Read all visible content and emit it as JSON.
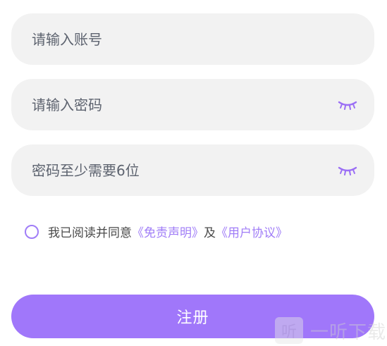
{
  "form": {
    "account": {
      "value": "",
      "placeholder": "请输入账号"
    },
    "password": {
      "value": "",
      "placeholder": "请输入密码",
      "icon": "eye-closed-icon"
    },
    "password_confirm": {
      "value": "",
      "placeholder": "密码至少需要6位",
      "icon": "eye-closed-icon"
    }
  },
  "agreement": {
    "checked": false,
    "prefix": "我已阅读并同意",
    "disclaimer_link": "《免责声明》",
    "conjunction": "及",
    "user_agreement_link": "《用户协议》"
  },
  "register_button": {
    "label": "注册"
  },
  "watermark": {
    "logo_glyph": "听",
    "text": "一听下载"
  },
  "colors": {
    "accent": "#a077fa",
    "field_bg": "#f2f2f2",
    "placeholder": "#5d636f",
    "link": "#a07df7"
  }
}
